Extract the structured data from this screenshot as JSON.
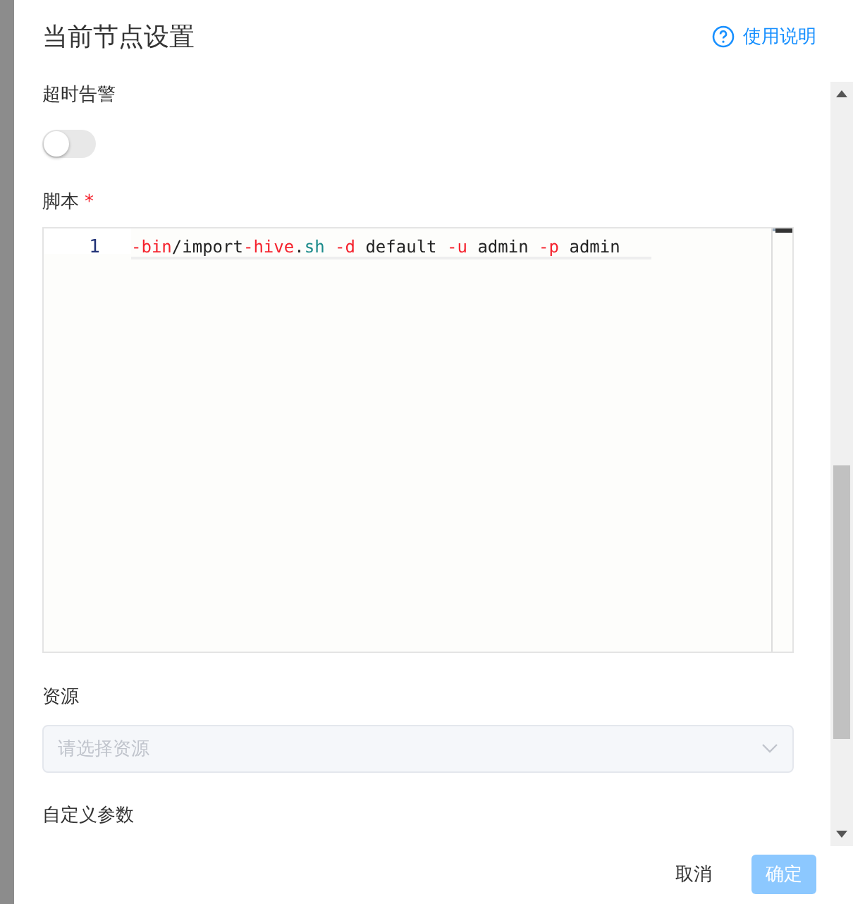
{
  "dialog": {
    "title": "当前节点设置",
    "help_link": "使用说明"
  },
  "fields": [
    {
      "kind": "switch",
      "label": "超时告警",
      "on": false
    },
    {
      "kind": "editor",
      "label": "脚本",
      "required_mark": "*",
      "line_number": "1",
      "tokens": [
        {
          "text": "-bin",
          "kind": "flag"
        },
        {
          "text": "/import",
          "kind": "plain"
        },
        {
          "text": "-hive",
          "kind": "flag"
        },
        {
          "text": ".",
          "kind": "plain"
        },
        {
          "text": "sh",
          "kind": "ext"
        },
        {
          "text": " -d",
          "kind": "flag"
        },
        {
          "text": " default ",
          "kind": "plain"
        },
        {
          "text": "-u",
          "kind": "flag"
        },
        {
          "text": " admin ",
          "kind": "plain"
        },
        {
          "text": "-p",
          "kind": "flag"
        },
        {
          "text": " admin",
          "kind": "plain"
        }
      ]
    },
    {
      "kind": "select",
      "label": "资源",
      "placeholder": "请选择资源",
      "disabled": true
    },
    {
      "kind": "section",
      "label": "自定义参数"
    }
  ],
  "buttons": [
    {
      "label": "取消",
      "kind": "text",
      "disabled": false
    },
    {
      "label": "确定",
      "kind": "primary",
      "disabled": true
    }
  ]
}
